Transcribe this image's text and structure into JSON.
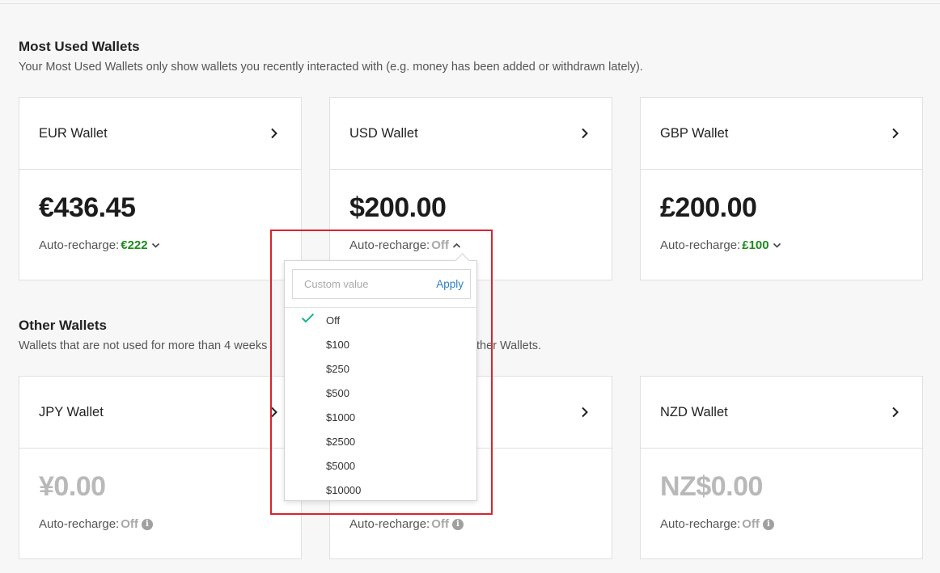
{
  "most_used": {
    "title": "Most Used Wallets",
    "subtitle": "Your Most Used Wallets only show wallets you recently interacted with (e.g. money has been added or withdrawn lately)."
  },
  "other": {
    "title": "Other Wallets",
    "subtitle_left": "Wallets that are not used for more than 4 weeks",
    "subtitle_right": "ther Wallets."
  },
  "wallets": [
    {
      "name": "EUR Wallet",
      "amount": "€436.45",
      "recharge_label": "Auto-recharge:",
      "recharge_value": "€222"
    },
    {
      "name": "USD Wallet",
      "amount": "$200.00",
      "recharge_label": "Auto-recharge:",
      "recharge_value": "Off"
    },
    {
      "name": "GBP Wallet",
      "amount": "£200.00",
      "recharge_label": "Auto-recharge:",
      "recharge_value": "£100"
    },
    {
      "name": "JPY Wallet",
      "amount": "¥0.00",
      "recharge_label": "Auto-recharge:",
      "recharge_value": "Off"
    },
    {
      "name": "",
      "amount": "",
      "recharge_label": "Auto-recharge:",
      "recharge_value": "Off"
    },
    {
      "name": "NZD Wallet",
      "amount": "NZ$0.00",
      "recharge_label": "Auto-recharge:",
      "recharge_value": "Off"
    }
  ],
  "dropdown": {
    "placeholder": "Custom value",
    "apply_label": "Apply",
    "selected": "Off",
    "options": [
      "Off",
      "$100",
      "$250",
      "$500",
      "$1000",
      "$2500",
      "$5000",
      "$10000"
    ]
  },
  "colors": {
    "accent_green": "#1e8a1e",
    "link_blue": "#2d7fc1",
    "check_teal": "#1ab394",
    "highlight_red": "#d9232d"
  },
  "icons": {
    "chevron": "chevron-right-icon",
    "caret_down": "chevron-down-icon",
    "caret_up": "chevron-up-icon",
    "info": "info-icon",
    "check": "check-icon"
  }
}
